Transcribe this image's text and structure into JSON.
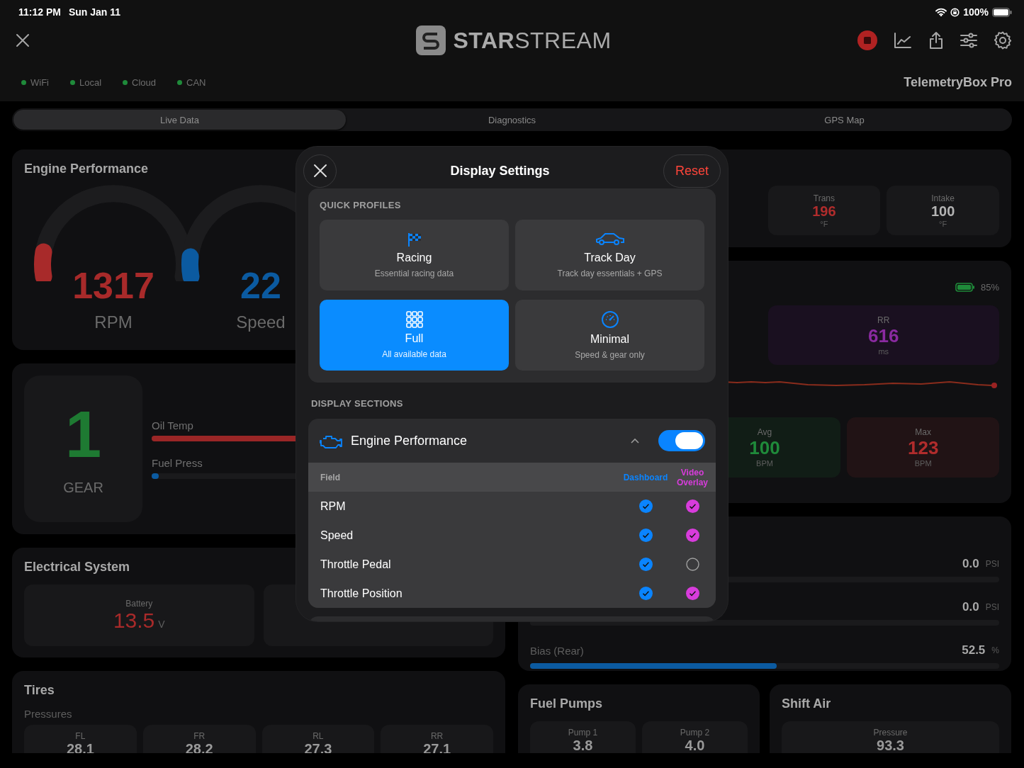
{
  "status_bar": {
    "time": "11:12 PM",
    "date": "Sun Jan 11",
    "battery": "100%"
  },
  "header": {
    "logo": "**STAR**STREAM",
    "device": "TelemetryBox Pro",
    "recording": true
  },
  "connections": [
    {
      "label": "WiFi",
      "color": "#1f8a3a"
    },
    {
      "label": "Local",
      "color": "#1f8a3a"
    },
    {
      "label": "Cloud",
      "color": "#1f8a3a"
    },
    {
      "label": "CAN",
      "color": "#1f8a3a"
    }
  ],
  "tabs": [
    {
      "label": "Live Data",
      "selected": true
    },
    {
      "label": "Diagnostics",
      "selected": false
    },
    {
      "label": "GPS Map",
      "selected": false
    }
  ],
  "engine_performance": {
    "title": "Engine Performance",
    "gauges": [
      {
        "value": "1317",
        "label": "RPM",
        "level": 0.1,
        "color": "#a82a2a"
      },
      {
        "value": "22",
        "label": "Speed",
        "level": 0.08,
        "color": "#0b5aa0"
      }
    ]
  },
  "gear_panel": {
    "gear": "1",
    "label": "GEAR",
    "bars": [
      {
        "label": "Oil Temp",
        "level": 0.9,
        "color": "#9a2626"
      },
      {
        "label": "Fuel Press",
        "level": 0.02,
        "color": "#0b5aa0"
      }
    ]
  },
  "electrical": {
    "title": "Electrical System",
    "cards": [
      {
        "label": "Battery",
        "value": "13.5",
        "unit": "V",
        "color": "#a82a2a"
      }
    ]
  },
  "tires": {
    "title": "Tires",
    "subtitle": "Pressures",
    "cards": [
      {
        "label": "FL",
        "value": "28.1"
      },
      {
        "label": "FR",
        "value": "28.2"
      },
      {
        "label": "RL",
        "value": "27.3"
      },
      {
        "label": "RR",
        "value": "27.1"
      }
    ]
  },
  "temperatures": {
    "cards": [
      {
        "label": "Trans",
        "value": "196",
        "unit": "°F",
        "color": "#b02c2c"
      },
      {
        "label": "Intake",
        "value": "100",
        "unit": "°F",
        "color": "#b4b4b4"
      }
    ]
  },
  "heart_rate": {
    "battery": "85%",
    "rr": {
      "label": "RR",
      "value": "616",
      "unit": "ms"
    },
    "stats": [
      {
        "label": "Avg",
        "value": "100",
        "unit": "BPM",
        "color": "#1f8a3a"
      },
      {
        "label": "Max",
        "value": "123",
        "unit": "BPM",
        "color": "#b02c2c"
      }
    ]
  },
  "pressures": {
    "rows": [
      {
        "value": "0.0",
        "unit": "PSI"
      },
      {
        "value": "0.0",
        "unit": "PSI"
      },
      {
        "label": "Bias (Rear)",
        "value": "52.5",
        "unit": "%",
        "level": 0.525
      }
    ]
  },
  "fuel_pumps": {
    "title": "Fuel Pumps",
    "cards": [
      {
        "label": "Pump 1",
        "value": "3.8"
      },
      {
        "label": "Pump 2",
        "value": "4.0"
      }
    ]
  },
  "shift_air": {
    "title": "Shift Air",
    "cards": [
      {
        "label": "Pressure",
        "value": "93.3"
      }
    ]
  },
  "display_settings": {
    "title": "Display Settings",
    "reset": "Reset",
    "quick_profiles": {
      "label": "QUICK PROFILES",
      "profiles": [
        {
          "kind": "flag",
          "title": "Racing",
          "subtitle": "Essential racing data",
          "selected": false
        },
        {
          "kind": "car",
          "title": "Track Day",
          "subtitle": "Track day essentials + GPS",
          "selected": false
        },
        {
          "kind": "grid",
          "title": "Full",
          "subtitle": "All available data",
          "selected": true
        },
        {
          "kind": "gauge",
          "title": "Minimal",
          "subtitle": "Speed & gear only",
          "selected": false
        }
      ]
    },
    "sections_label": "DISPLAY SECTIONS",
    "section": {
      "title": "Engine Performance",
      "expanded": true,
      "enabled": true,
      "columns": [
        "Field",
        "Dashboard",
        "Video Overlay"
      ],
      "rows": [
        {
          "name": "RPM",
          "dashboard": true,
          "overlay": true
        },
        {
          "name": "Speed",
          "dashboard": true,
          "overlay": true
        },
        {
          "name": "Throttle Pedal",
          "dashboard": true,
          "overlay": false
        },
        {
          "name": "Throttle Position",
          "dashboard": true,
          "overlay": true
        }
      ]
    }
  }
}
